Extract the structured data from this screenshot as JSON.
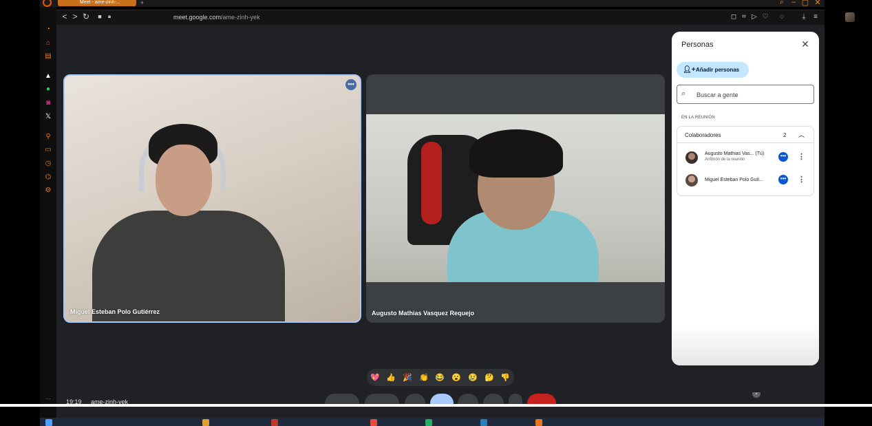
{
  "browser": {
    "tab_title": "Meet - ame-zinh-...",
    "new_tab": "+",
    "url_host": "meet.google.com",
    "url_path": "/ame-zinh-yek",
    "back": "<",
    "forward": ">",
    "reload": "↻"
  },
  "tiles": [
    {
      "name": "Miguel Esteban Polo Gutiérrez",
      "more": "•••"
    },
    {
      "name": "Augusto Mathias Vasquez Requejo"
    }
  ],
  "panel": {
    "title": "Personas",
    "close": "✕",
    "add_people": "Añadir personas",
    "search_placeholder": "Buscar a gente",
    "section_label": "EN LA REUNIÓN",
    "group_title": "Colaboradores",
    "group_count": "2",
    "participants": [
      {
        "name": "Augusto Mathias Vas... (Tú)",
        "subtitle": "Anfitrión de la reunión",
        "badge": "•••",
        "menu": "⋮"
      },
      {
        "name": "Miguel Esteban Polo Guti...",
        "subtitle": "",
        "badge": "•••",
        "menu": "⋮"
      }
    ]
  },
  "reactions": [
    "💖",
    "👍",
    "🎉",
    "👏",
    "😂",
    "😮",
    "😢",
    "🤔",
    "👎"
  ],
  "controls": {
    "time": "19:19",
    "meeting_code": "ame-zinh-yek",
    "people_count": "2"
  },
  "colors": {
    "accent": "#e8761d",
    "stage": "#202124",
    "active_border": "#a8c7fa",
    "add_button": "#c2e7ff",
    "end_call": "#c5221f"
  }
}
